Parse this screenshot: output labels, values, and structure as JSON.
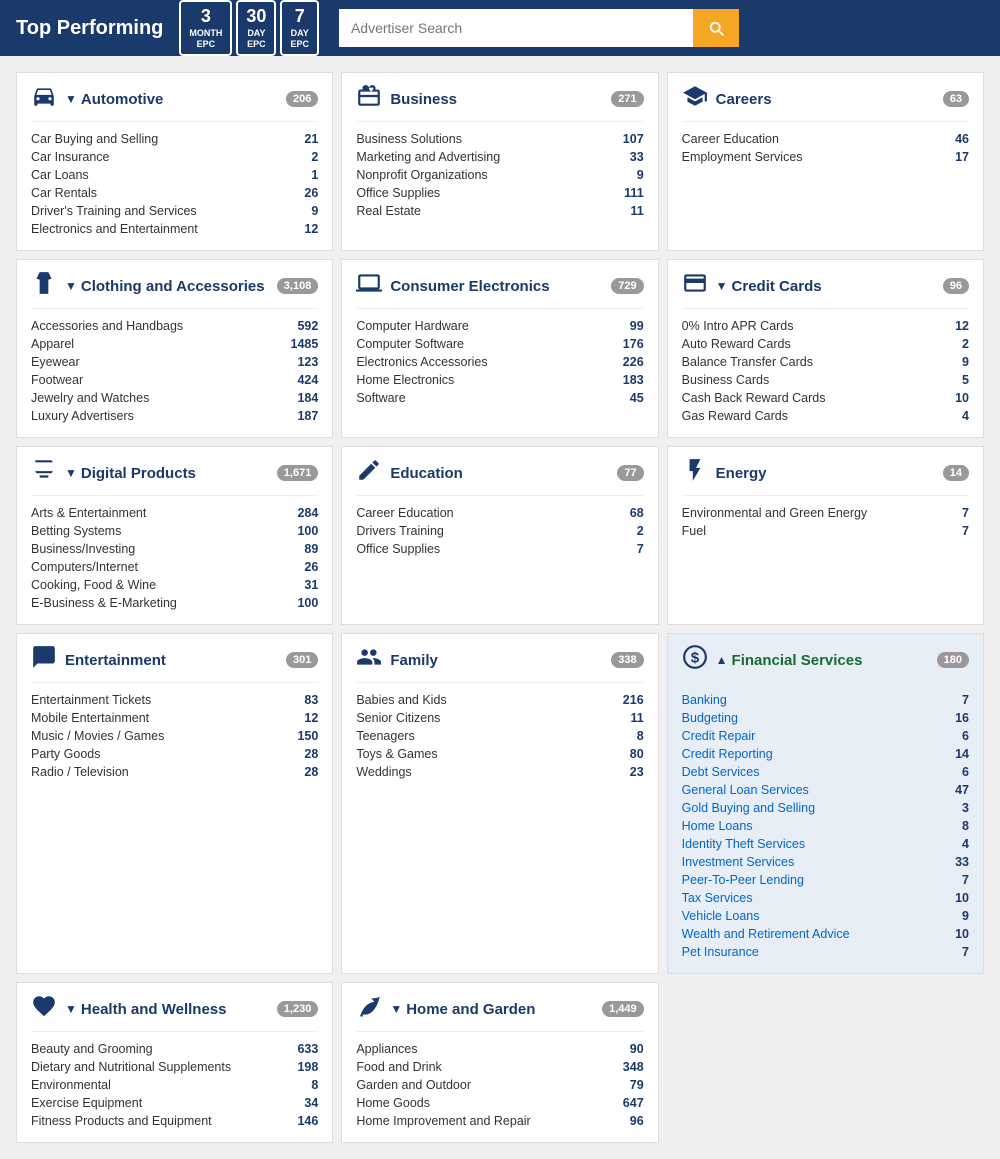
{
  "header": {
    "title": "Top Performing",
    "epc_buttons": [
      {
        "big": "3",
        "small": "MONTH\nEPC"
      },
      {
        "big": "30",
        "small": "DAY\nEPC"
      },
      {
        "big": "7",
        "small": "DAY\nEPC"
      }
    ],
    "search_placeholder": "Advertiser Search",
    "search_icon": "🔍"
  },
  "categories": [
    {
      "id": "automotive",
      "icon": "🚗",
      "title": "Automotive",
      "arrow": "▼",
      "count": "206",
      "col": 1,
      "row": 1,
      "items": [
        {
          "name": "Car Buying and Selling",
          "count": "21"
        },
        {
          "name": "Car Insurance",
          "count": "2"
        },
        {
          "name": "Car Loans",
          "count": "1"
        },
        {
          "name": "Car Rentals",
          "count": "26"
        },
        {
          "name": "Driver's Training and Services",
          "count": "9"
        },
        {
          "name": "Electronics and Entertainment",
          "count": "12"
        }
      ]
    },
    {
      "id": "business",
      "icon": "💼",
      "title": "Business",
      "arrow": "",
      "count": "271",
      "col": 2,
      "row": 1,
      "items": [
        {
          "name": "Business Solutions",
          "count": "107"
        },
        {
          "name": "Marketing and Advertising",
          "count": "33"
        },
        {
          "name": "Nonprofit Organizations",
          "count": "9"
        },
        {
          "name": "Office Supplies",
          "count": "111"
        },
        {
          "name": "Real Estate",
          "count": "11"
        }
      ]
    },
    {
      "id": "careers",
      "icon": "🎓",
      "title": "Careers",
      "arrow": "",
      "count": "63",
      "col": 3,
      "row": 1,
      "items": [
        {
          "name": "Career Education",
          "count": "46"
        },
        {
          "name": "Employment Services",
          "count": "17"
        }
      ]
    },
    {
      "id": "clothing",
      "icon": "👜",
      "title": "Clothing and Accessories",
      "arrow": "▼",
      "count": "3,108",
      "col": 1,
      "row": 2,
      "items": [
        {
          "name": "Accessories and Handbags",
          "count": "592"
        },
        {
          "name": "Apparel",
          "count": "1485"
        },
        {
          "name": "Eyewear",
          "count": "123"
        },
        {
          "name": "Footwear",
          "count": "424"
        },
        {
          "name": "Jewelry and Watches",
          "count": "184"
        },
        {
          "name": "Luxury Advertisers",
          "count": "187"
        }
      ]
    },
    {
      "id": "consumer-electronics",
      "icon": "🖥",
      "title": "Consumer Electronics",
      "arrow": "",
      "count": "729",
      "col": 2,
      "row": 2,
      "items": [
        {
          "name": "Computer Hardware",
          "count": "99"
        },
        {
          "name": "Computer Software",
          "count": "176"
        },
        {
          "name": "Electronics Accessories",
          "count": "226"
        },
        {
          "name": "Home Electronics",
          "count": "183"
        },
        {
          "name": "Software",
          "count": "45"
        }
      ]
    },
    {
      "id": "credit-cards",
      "icon": "💳",
      "title": "Credit Cards",
      "arrow": "▼",
      "count": "96",
      "col": 3,
      "row": 2,
      "items": [
        {
          "name": "0% Intro APR Cards",
          "count": "12"
        },
        {
          "name": "Auto Reward Cards",
          "count": "2"
        },
        {
          "name": "Balance Transfer Cards",
          "count": "9"
        },
        {
          "name": "Business Cards",
          "count": "5"
        },
        {
          "name": "Cash Back Reward Cards",
          "count": "10"
        },
        {
          "name": "Gas Reward Cards",
          "count": "4"
        }
      ]
    },
    {
      "id": "digital-products",
      "icon": "💻",
      "title": "Digital Products",
      "arrow": "▼",
      "count": "1,671",
      "col": 1,
      "row": 3,
      "items": [
        {
          "name": "Arts & Entertainment",
          "count": "284"
        },
        {
          "name": "Betting Systems",
          "count": "100"
        },
        {
          "name": "Business/Investing",
          "count": "89"
        },
        {
          "name": "Computers/Internet",
          "count": "26"
        },
        {
          "name": "Cooking, Food & Wine",
          "count": "31"
        },
        {
          "name": "E-Business & E-Marketing",
          "count": "100"
        }
      ]
    },
    {
      "id": "education",
      "icon": "✏️",
      "title": "Education",
      "arrow": "",
      "count": "77",
      "col": 2,
      "row": 3,
      "items": [
        {
          "name": "Career Education",
          "count": "68"
        },
        {
          "name": "Drivers Training",
          "count": "2"
        },
        {
          "name": "Office Supplies",
          "count": "7"
        }
      ]
    },
    {
      "id": "energy",
      "icon": "⚡",
      "title": "Energy",
      "arrow": "",
      "count": "14",
      "col": 3,
      "row": 3,
      "items": [
        {
          "name": "Environmental and Green Energy",
          "count": "7"
        },
        {
          "name": "Fuel",
          "count": "7"
        }
      ]
    },
    {
      "id": "entertainment",
      "icon": "🎭",
      "title": "Entertainment",
      "arrow": "",
      "count": "301",
      "col": 1,
      "row": 4,
      "items": [
        {
          "name": "Entertainment Tickets",
          "count": "83"
        },
        {
          "name": "Mobile Entertainment",
          "count": "12"
        },
        {
          "name": "Music / Movies / Games",
          "count": "150"
        },
        {
          "name": "Party Goods",
          "count": "28"
        },
        {
          "name": "Radio / Television",
          "count": "28"
        }
      ]
    },
    {
      "id": "family",
      "icon": "👨‍👩‍👧",
      "title": "Family",
      "arrow": "",
      "count": "338",
      "col": 2,
      "row": 4,
      "items": [
        {
          "name": "Babies and Kids",
          "count": "216"
        },
        {
          "name": "Senior Citizens",
          "count": "11"
        },
        {
          "name": "Teenagers",
          "count": "8"
        },
        {
          "name": "Toys & Games",
          "count": "80"
        },
        {
          "name": "Weddings",
          "count": "23"
        }
      ]
    },
    {
      "id": "financial-services",
      "icon": "💰",
      "title": "Financial Services",
      "arrow": "▲",
      "count": "180",
      "col": 3,
      "row": 4,
      "highlighted": true,
      "items": [
        {
          "name": "Banking",
          "count": "7"
        },
        {
          "name": "Budgeting",
          "count": "16"
        },
        {
          "name": "Credit Repair",
          "count": "6"
        },
        {
          "name": "Credit Reporting",
          "count": "14"
        },
        {
          "name": "Debt Services",
          "count": "6"
        },
        {
          "name": "General Loan Services",
          "count": "47"
        },
        {
          "name": "Gold Buying and Selling",
          "count": "3"
        },
        {
          "name": "Home Loans",
          "count": "8"
        },
        {
          "name": "Identity Theft Services",
          "count": "4"
        },
        {
          "name": "Investment Services",
          "count": "33"
        },
        {
          "name": "Peer-To-Peer Lending",
          "count": "7"
        },
        {
          "name": "Tax Services",
          "count": "10"
        },
        {
          "name": "Vehicle Loans",
          "count": "9"
        },
        {
          "name": "Wealth and Retirement Advice",
          "count": "10"
        }
      ]
    },
    {
      "id": "health-wellness",
      "icon": "❤️",
      "title": "Health and Wellness",
      "arrow": "▼",
      "count": "1,230",
      "col": 1,
      "row": 5,
      "items": [
        {
          "name": "Beauty and Grooming",
          "count": "633"
        },
        {
          "name": "Dietary and Nutritional Supplements",
          "count": "198"
        },
        {
          "name": "Environmental",
          "count": "8"
        },
        {
          "name": "Exercise Equipment",
          "count": "34"
        },
        {
          "name": "Fitness Products and Equipment",
          "count": "146"
        }
      ]
    },
    {
      "id": "home-garden",
      "icon": "🌿",
      "title": "Home and Garden",
      "arrow": "▼",
      "count": "1,449",
      "col": 2,
      "row": 5,
      "items": [
        {
          "name": "Appliances",
          "count": "90"
        },
        {
          "name": "Food and Drink",
          "count": "348"
        },
        {
          "name": "Garden and Outdoor",
          "count": "79"
        },
        {
          "name": "Home Goods",
          "count": "647"
        },
        {
          "name": "Home Improvement and Repair",
          "count": "96"
        }
      ]
    }
  ],
  "financial_extra": {
    "name": "Pet Insurance",
    "count": "7"
  }
}
